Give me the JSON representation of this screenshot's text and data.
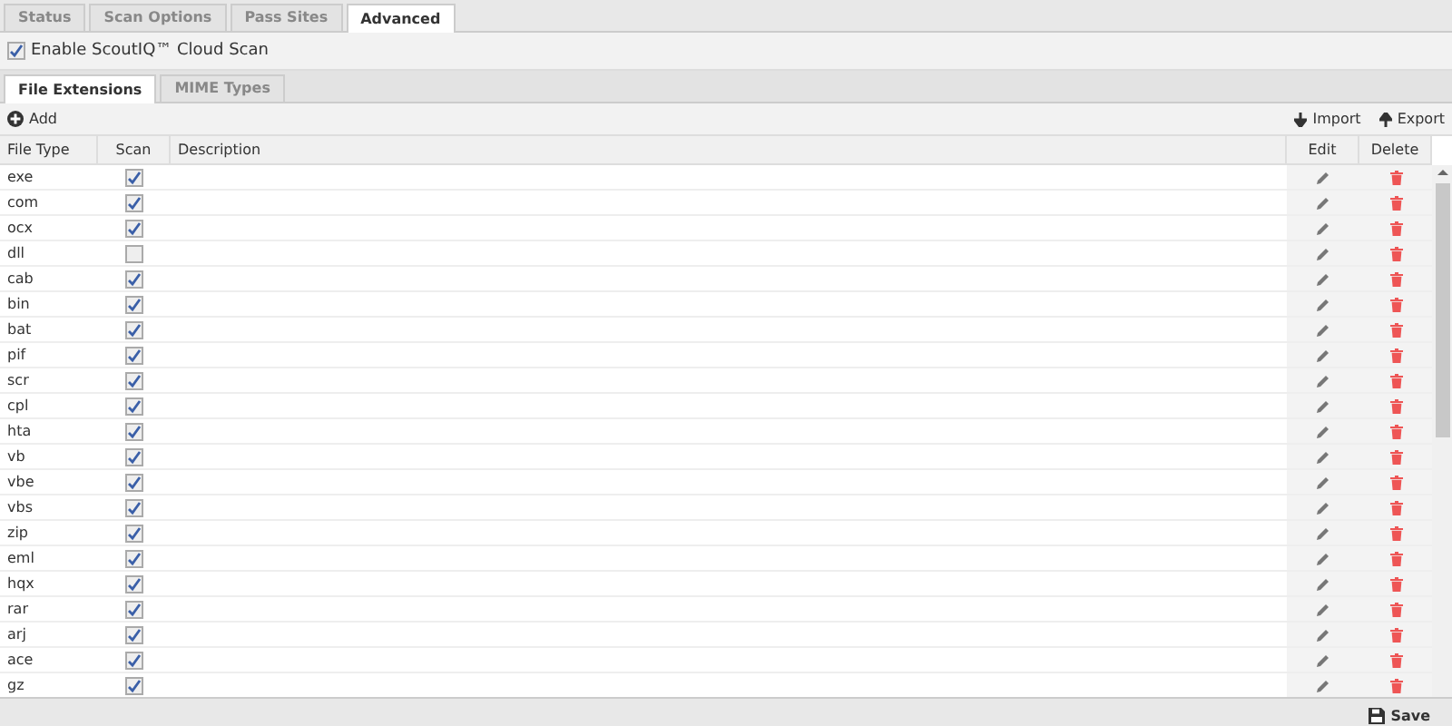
{
  "tabs": [
    {
      "label": "Status",
      "selected": false
    },
    {
      "label": "Scan Options",
      "selected": false
    },
    {
      "label": "Pass Sites",
      "selected": false
    },
    {
      "label": "Advanced",
      "selected": true
    }
  ],
  "cloud_scan": {
    "label": "Enable ScoutIQ™ Cloud Scan",
    "checked": true
  },
  "subtabs": [
    {
      "label": "File Extensions",
      "selected": true
    },
    {
      "label": "MIME Types",
      "selected": false
    }
  ],
  "toolbar": {
    "add": "Add",
    "import": "Import",
    "export": "Export"
  },
  "table": {
    "columns": [
      "File Type",
      "Scan",
      "Description",
      "Edit",
      "Delete"
    ],
    "rows": [
      {
        "file_type": "exe",
        "scan": true
      },
      {
        "file_type": "com",
        "scan": true
      },
      {
        "file_type": "ocx",
        "scan": true
      },
      {
        "file_type": "dll",
        "scan": false
      },
      {
        "file_type": "cab",
        "scan": true
      },
      {
        "file_type": "bin",
        "scan": true
      },
      {
        "file_type": "bat",
        "scan": true
      },
      {
        "file_type": "pif",
        "scan": true
      },
      {
        "file_type": "scr",
        "scan": true
      },
      {
        "file_type": "cpl",
        "scan": true
      },
      {
        "file_type": "hta",
        "scan": true
      },
      {
        "file_type": "vb",
        "scan": true
      },
      {
        "file_type": "vbe",
        "scan": true
      },
      {
        "file_type": "vbs",
        "scan": true
      },
      {
        "file_type": "zip",
        "scan": true
      },
      {
        "file_type": "eml",
        "scan": true
      },
      {
        "file_type": "hqx",
        "scan": true
      },
      {
        "file_type": "rar",
        "scan": true
      },
      {
        "file_type": "arj",
        "scan": true
      },
      {
        "file_type": "ace",
        "scan": true
      },
      {
        "file_type": "gz",
        "scan": true
      }
    ]
  },
  "footer": {
    "save": "Save"
  }
}
